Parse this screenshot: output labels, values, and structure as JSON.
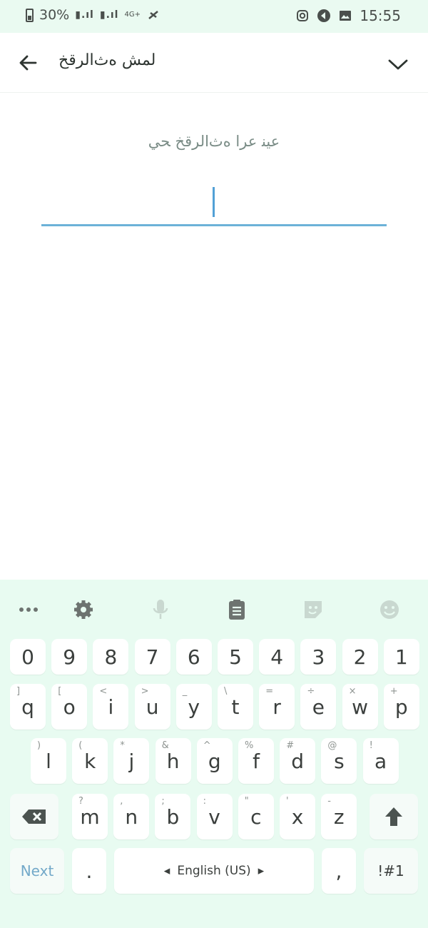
{
  "status_bar": {
    "battery": "30%",
    "time": "15:55",
    "net": "4G+"
  },
  "app_bar": {
    "title": "ﻟﻤﺶ ﻩﺙﺍﻟﺮﻗﺦ"
  },
  "content": {
    "subtitle": "ﻋﻴﻨ ﻋﺮﺍ ﻩﺙﺍﻟﺮﻗﺦ ﺤﻲ"
  },
  "keyboard": {
    "toolbar": [
      "more-dots-icon",
      "gear-icon",
      "microphone-icon",
      "clipboard-icon",
      "sticker-icon",
      "emoji-icon"
    ],
    "row1": [
      "0",
      "9",
      "8",
      "7",
      "6",
      "5",
      "4",
      "3",
      "2",
      "1"
    ],
    "row2": [
      {
        "k": "q",
        "s": "]"
      },
      {
        "k": "o",
        "s": "["
      },
      {
        "k": "i",
        "s": "<"
      },
      {
        "k": "u",
        "s": ">"
      },
      {
        "k": "y",
        "s": "_"
      },
      {
        "k": "t",
        "s": "\\"
      },
      {
        "k": "r",
        "s": "="
      },
      {
        "k": "e",
        "s": "÷"
      },
      {
        "k": "w",
        "s": "×"
      },
      {
        "k": "p",
        "s": "+"
      }
    ],
    "row3": [
      {
        "k": "l",
        "s": ")"
      },
      {
        "k": "k",
        "s": "("
      },
      {
        "k": "j",
        "s": "*"
      },
      {
        "k": "h",
        "s": "&"
      },
      {
        "k": "g",
        "s": "^"
      },
      {
        "k": "f",
        "s": "%"
      },
      {
        "k": "d",
        "s": "#"
      },
      {
        "k": "s",
        "s": "@"
      },
      {
        "k": "a",
        "s": "!"
      }
    ],
    "row4": [
      {
        "k": "m",
        "s": "?"
      },
      {
        "k": "n",
        "s": ","
      },
      {
        "k": "b",
        "s": ";"
      },
      {
        "k": "v",
        "s": ":"
      },
      {
        "k": "c",
        "s": "\""
      },
      {
        "k": "x",
        "s": "'"
      },
      {
        "k": "z",
        "s": "-"
      }
    ],
    "next_label": "Next",
    "period": ".",
    "space_label": "English (US)",
    "comma": ",",
    "symbols_label": "!#1"
  },
  "colors": {
    "accent": "#6cb2d8",
    "keyboard_bg": "#e8fbf1",
    "status_bg": "#eafaf1"
  }
}
